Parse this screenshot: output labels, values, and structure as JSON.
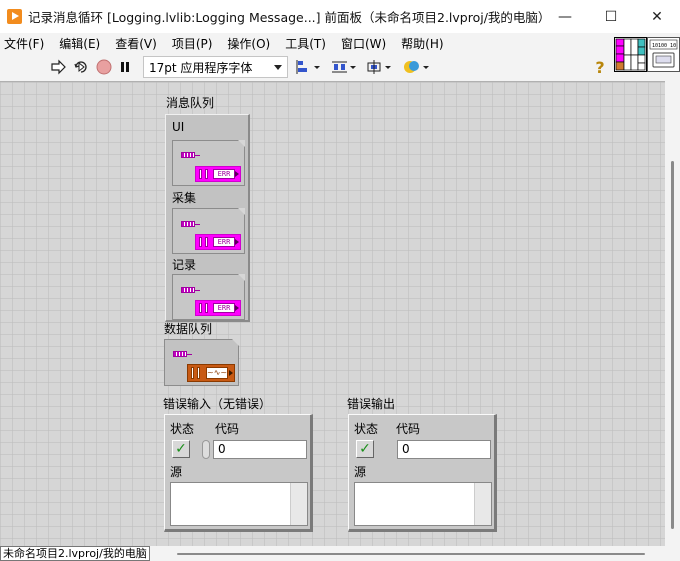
{
  "window": {
    "title": "记录消息循环 [Logging.lvlib:Logging Message...] 前面板（未命名项目2.lvproj/我的电脑）",
    "minimize": "—",
    "maximize": "☐",
    "close": "✕"
  },
  "menu": [
    "文件(F)",
    "编辑(E)",
    "查看(V)",
    "项目(P)",
    "操作(O)",
    "工具(T)",
    "窗口(W)",
    "帮助(H)"
  ],
  "toolbar": {
    "font_value": "17pt 应用程序字体",
    "help_icon": "?"
  },
  "panel": {
    "message_queue_label": "消息队列",
    "queue_items": [
      {
        "label": "UI",
        "type_text": "ERR"
      },
      {
        "label": "采集",
        "type_text": "ERR"
      },
      {
        "label": "记录",
        "type_text": "ERR"
      }
    ],
    "data_queue_label": "数据队列",
    "data_queue_glyph": "~∿~",
    "error_in": {
      "label": "错误输入（无错误）",
      "status_label": "状态",
      "code_label": "代码",
      "status_mark": "✓",
      "code_value": "0",
      "source_label": "源"
    },
    "error_out": {
      "label": "错误输出",
      "status_label": "状态",
      "code_label": "代码",
      "status_mark": "✓",
      "code_value": "0",
      "source_label": "源"
    }
  },
  "statusbar": {
    "project_path": "未命名项目2.lvproj/我的电脑"
  }
}
